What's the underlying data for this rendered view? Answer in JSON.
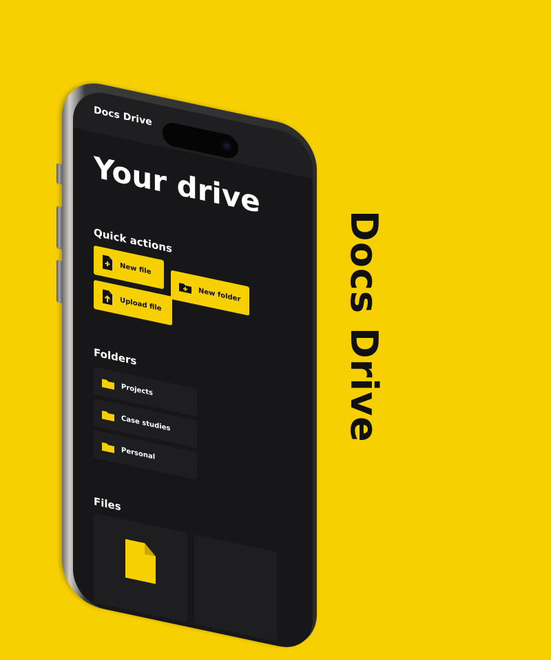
{
  "brand": {
    "vertical_title": "Docs Drive"
  },
  "app": {
    "title": "Docs Drive"
  },
  "main": {
    "heading": "Your drive",
    "quick_actions": {
      "label": "Quick actions",
      "items": [
        {
          "label": "New file",
          "icon": "new-file-icon"
        },
        {
          "label": "New folder",
          "icon": "new-folder-icon"
        },
        {
          "label": "Upload file",
          "icon": "upload-file-icon"
        }
      ]
    },
    "folders": {
      "label": "Folders",
      "items": [
        {
          "label": "Projects",
          "icon": "folder-icon"
        },
        {
          "label": "Case studies",
          "icon": "folder-icon"
        },
        {
          "label": "Personal",
          "icon": "folder-icon"
        }
      ]
    },
    "files": {
      "label": "Files"
    }
  },
  "colors": {
    "accent": "#F7D001",
    "screen_bg": "#17171a",
    "card_bg": "#1e1e21",
    "text_dark": "#101010"
  }
}
